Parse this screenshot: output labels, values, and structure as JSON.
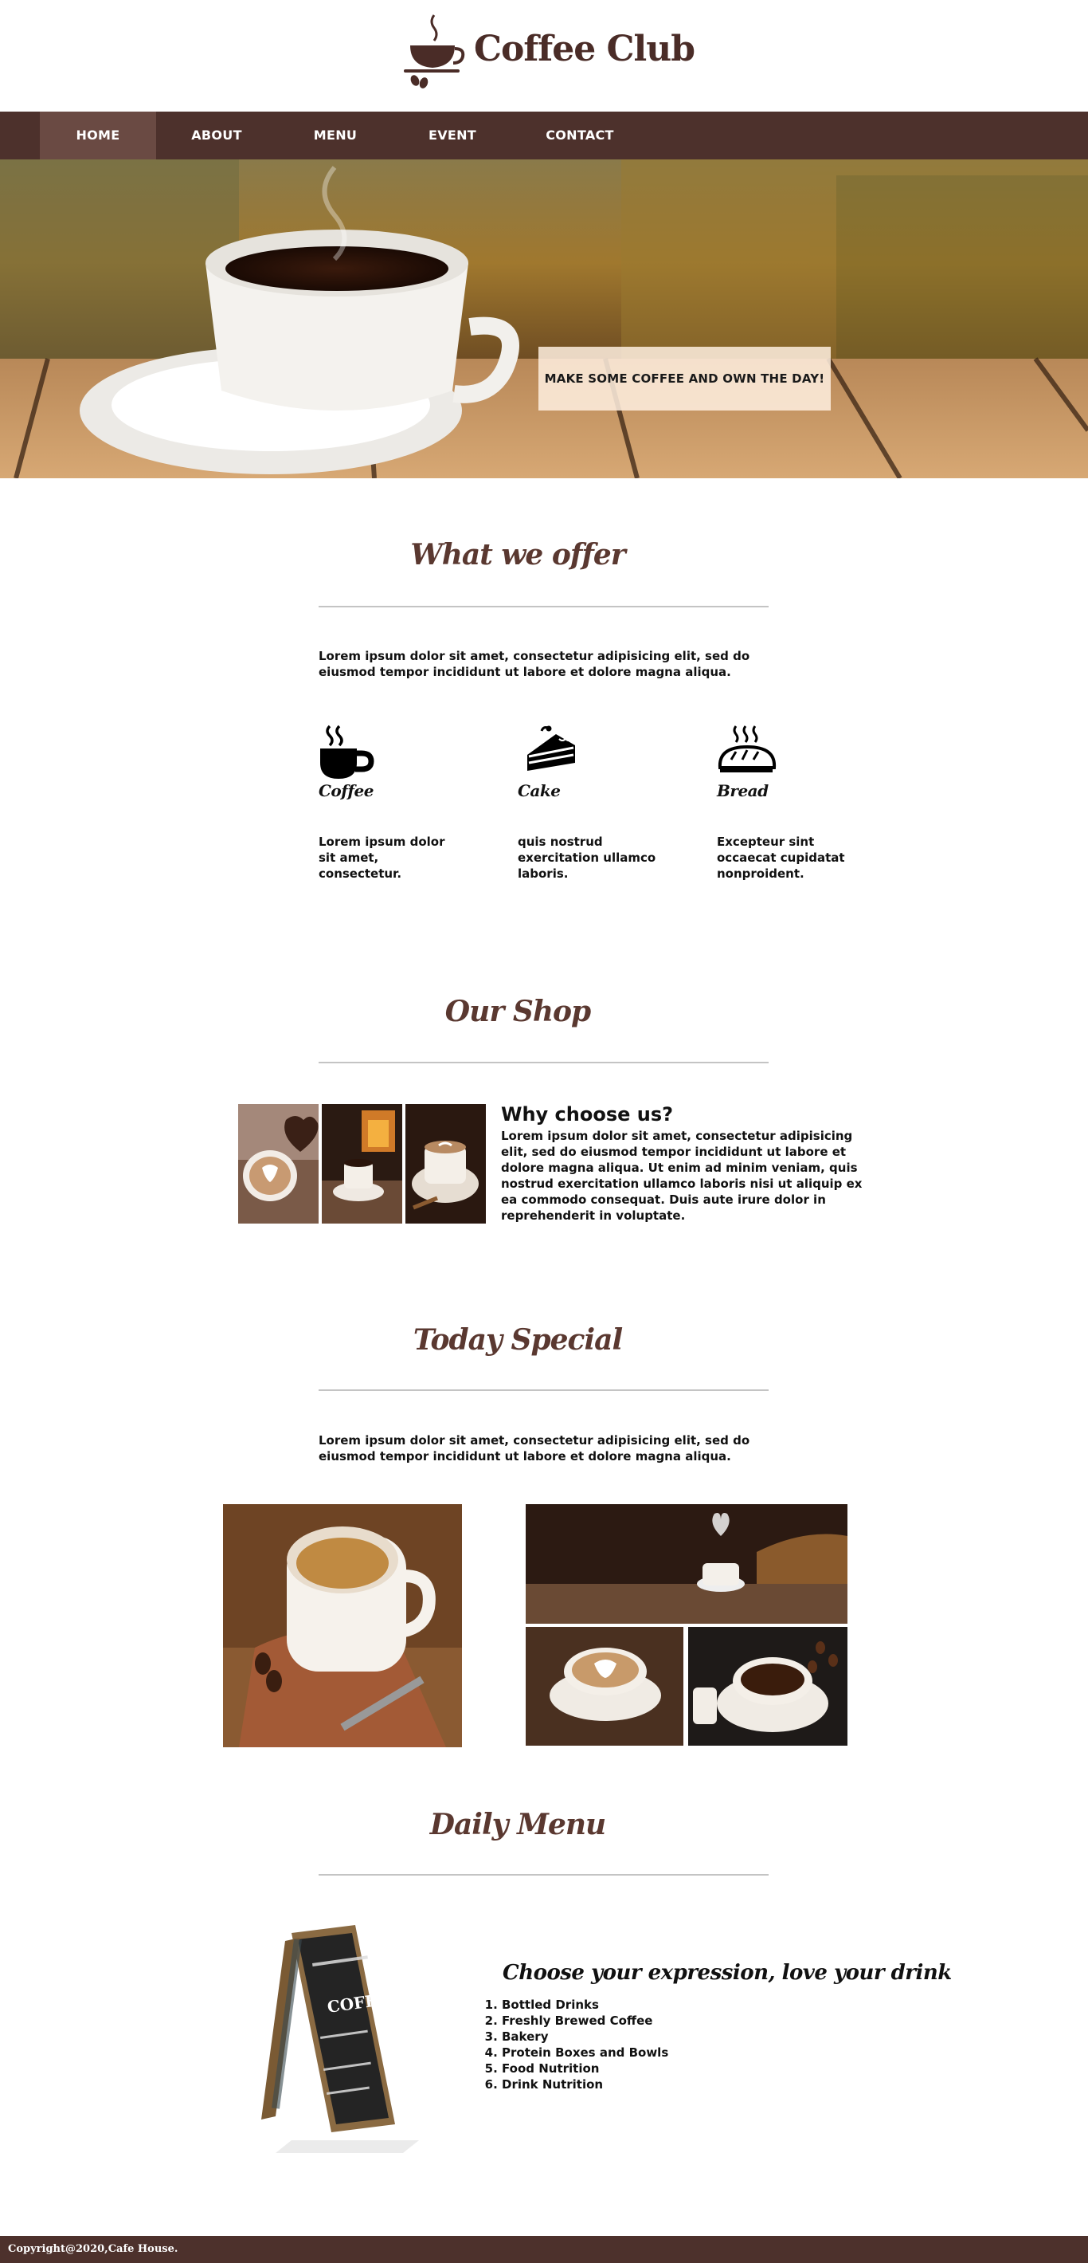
{
  "brand": {
    "name": "Coffee Club",
    "primary_color": "#4d312c",
    "accent_color": "#5a3830"
  },
  "nav": {
    "items": [
      {
        "label": "HOME",
        "active": true
      },
      {
        "label": "ABOUT",
        "active": false
      },
      {
        "label": "MENU",
        "active": false
      },
      {
        "label": "EVENT",
        "active": false
      },
      {
        "label": "CONTACT",
        "active": false
      }
    ]
  },
  "hero": {
    "tagline": "MAKE SOME COFFEE AND OWN THE DAY!"
  },
  "offer": {
    "title": "What we offer",
    "intro": "Lorem ipsum dolor sit amet, consectetur adipisicing elit, sed do eiusmod tempor incididunt ut labore et dolore magna aliqua.",
    "items": [
      {
        "name": "Coffee",
        "icon": "coffee-cup-icon",
        "text": "Lorem ipsum dolor sit amet, consectetur."
      },
      {
        "name": "Cake",
        "icon": "cake-slice-icon",
        "text": "quis nostrud exercitation ullamco laboris."
      },
      {
        "name": "Bread",
        "icon": "bread-icon",
        "text": "Excepteur sint occaecat cupidatat nonproident."
      }
    ]
  },
  "shop": {
    "title": "Our Shop",
    "why_title": "Why choose us?",
    "why_text": "Lorem ipsum dolor sit amet, consectetur adipisicing elit, sed do eiusmod tempor incididunt ut labore et dolore magna aliqua. Ut enim ad minim veniam, quis nostrud exercitation ullamco laboris nisi ut aliquip ex ea commodo consequat. Duis aute irure dolor in reprehenderit in voluptate."
  },
  "special": {
    "title": "Today Special",
    "intro": "Lorem ipsum dolor sit amet, consectetur adipisicing elit, sed do eiusmod tempor incididunt ut labore et dolore magna aliqua."
  },
  "menu": {
    "title": "Daily Menu",
    "heading": "Choose your expression, love your drink",
    "board_text": "COFFEE",
    "items": [
      "Bottled Drinks",
      "Freshly Brewed Coffee",
      "Bakery",
      "Protein Boxes and Bowls",
      "Food Nutrition",
      "Drink Nutrition"
    ]
  },
  "footer": {
    "copyright": "Copyright@2020,Cafe House."
  }
}
